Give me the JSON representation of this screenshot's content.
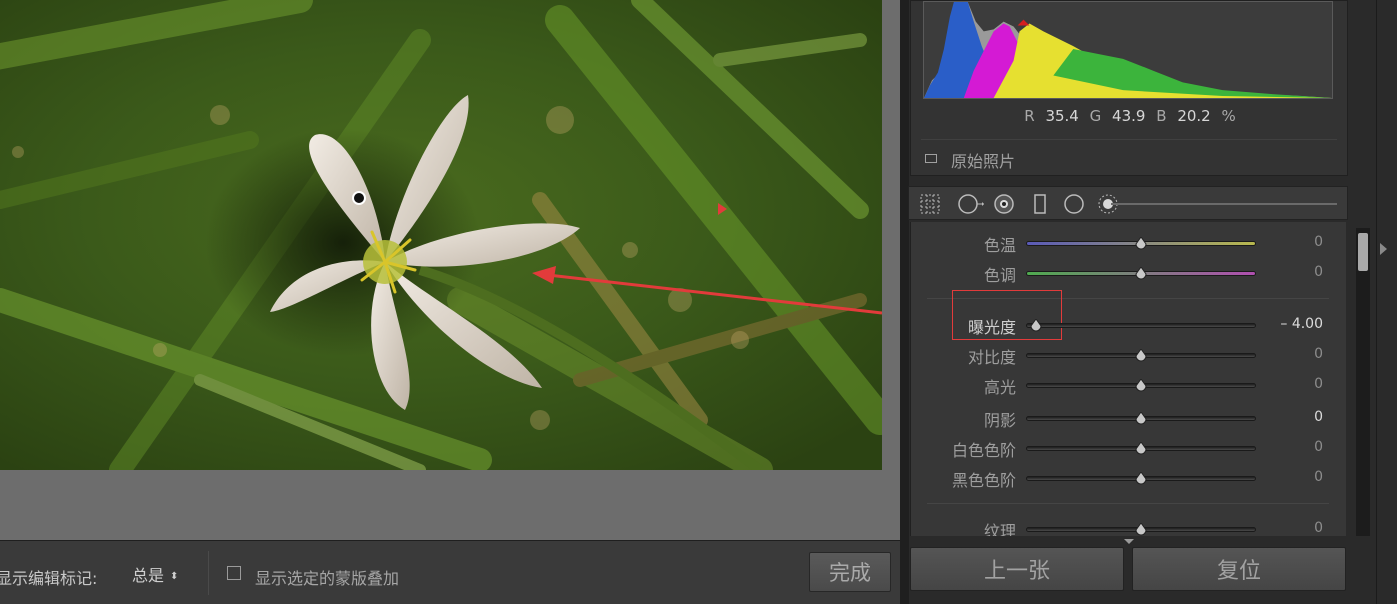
{
  "toolbar": {
    "edit_marks_label": "显示编辑标记:",
    "edit_marks_value": "总是",
    "show_overlay_label": "显示选定的蒙版叠加",
    "done_label": "完成"
  },
  "histogram": {
    "r_label": "R",
    "r_value": "35.4",
    "g_label": "G",
    "g_value": "43.9",
    "b_label": "B",
    "b_value": "20.2",
    "unit": "%"
  },
  "original_photo_label": "原始照片",
  "adjustments": {
    "temperature": {
      "label": "色温",
      "value": "0",
      "level": 0.5
    },
    "tint": {
      "label": "色调",
      "value": "0",
      "level": 0.5
    },
    "exposure": {
      "label": "曝光度",
      "value": "– 4.00",
      "level": 0.04
    },
    "contrast": {
      "label": "对比度",
      "value": "0",
      "level": 0.5
    },
    "highlights": {
      "label": "高光",
      "value": "0",
      "level": 0.5
    },
    "shadows": {
      "label": "阴影",
      "value": "0",
      "level": 0.5
    },
    "whites": {
      "label": "白色色阶",
      "value": "0",
      "level": 0.5
    },
    "blacks": {
      "label": "黑色色阶",
      "value": "0",
      "level": 0.5
    },
    "texture": {
      "label": "纹理",
      "value": "0",
      "level": 0.5
    }
  },
  "buttons": {
    "previous_label": "上一张",
    "reset_label": "复位"
  },
  "colors": {
    "annotation_red": "#e23b3b",
    "panel_bg": "#373737",
    "exposure_value": "#dcdcdc"
  },
  "icons": {
    "toolbar_checkbox": "checkbox-empty-icon",
    "tools": [
      "crop-grid-icon",
      "spot-heal-icon",
      "red-eye-icon",
      "graduated-filter-icon",
      "radial-filter-icon",
      "brush-icon"
    ]
  }
}
